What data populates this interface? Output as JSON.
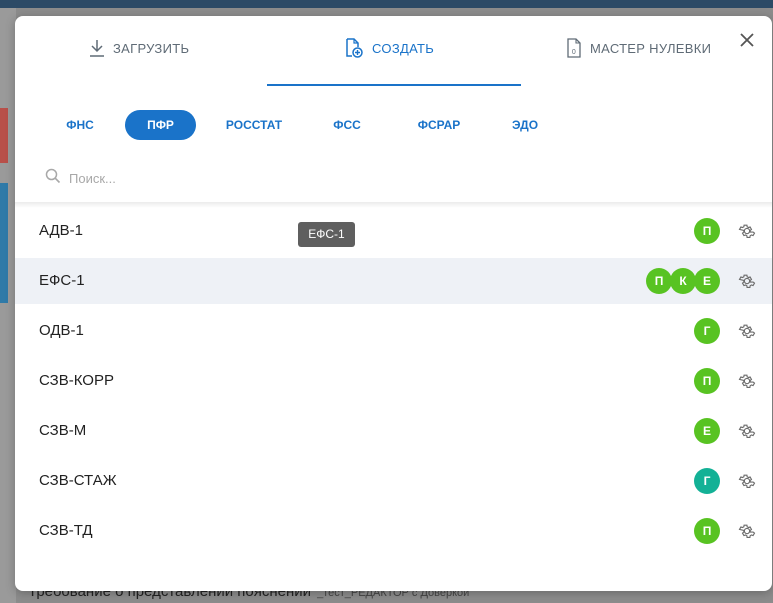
{
  "tabs": [
    {
      "label": "ЗАГРУЗИТЬ",
      "icon": "download-icon"
    },
    {
      "label": "СОЗДАТЬ",
      "icon": "create-document-icon",
      "active": true
    },
    {
      "label": "МАСТЕР НУЛЕВКИ",
      "icon": "zero-document-icon"
    }
  ],
  "chips": [
    "ФНС",
    "ПФР",
    "РОССТАТ",
    "ФСС",
    "ФСРАР",
    "ЭДО"
  ],
  "active_chip": "ПФР",
  "search": {
    "placeholder": "Поиск..."
  },
  "tooltip": "ЕФС-1",
  "rows": [
    {
      "name": "АДВ-1",
      "badges": [
        {
          "letter": "П",
          "color": "green"
        }
      ]
    },
    {
      "name": "ЕФС-1",
      "badges": [
        {
          "letter": "П",
          "color": "green"
        },
        {
          "letter": "К",
          "color": "green"
        },
        {
          "letter": "Е",
          "color": "green"
        }
      ],
      "highlighted": true
    },
    {
      "name": "ОДВ-1",
      "badges": [
        {
          "letter": "Г",
          "color": "green"
        }
      ]
    },
    {
      "name": "СЗВ-КОРР",
      "badges": [
        {
          "letter": "П",
          "color": "green"
        }
      ]
    },
    {
      "name": "СЗВ-М",
      "badges": [
        {
          "letter": "Е",
          "color": "green"
        }
      ]
    },
    {
      "name": "СЗВ-СТАЖ",
      "badges": [
        {
          "letter": "Г",
          "color": "teal"
        }
      ]
    },
    {
      "name": "СЗВ-ТД",
      "badges": [
        {
          "letter": "П",
          "color": "green"
        }
      ]
    }
  ],
  "background": {
    "bottom_text": "Требование о представлении пояснений",
    "bottom_small": "_тест_РЕДАКТОР с Доверкой"
  },
  "colors": {
    "accent": "#1a73c9",
    "badge_green": "#58c322",
    "badge_teal": "#13b196",
    "row_highlight": "#eef1f6"
  }
}
